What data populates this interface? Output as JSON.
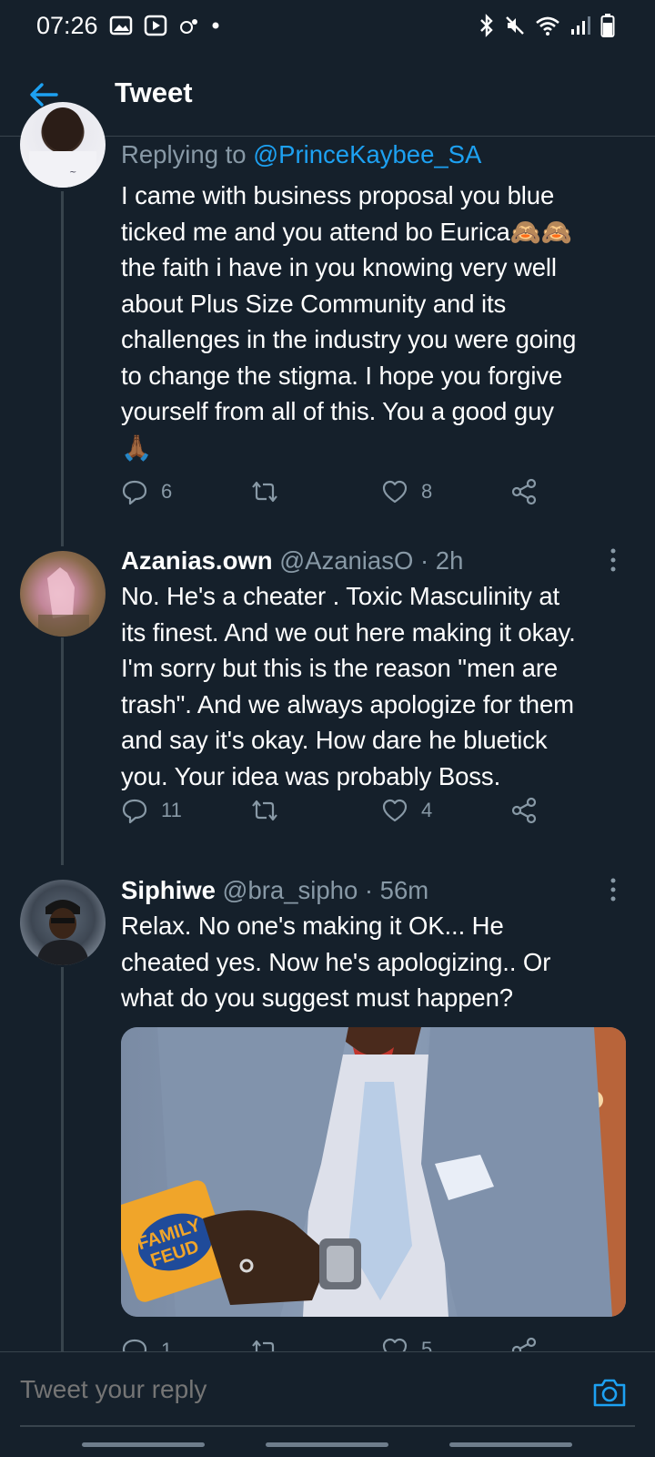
{
  "status_bar": {
    "time": "07:26",
    "icons_left": [
      "gallery-icon",
      "play-store-icon",
      "signal-notification-icon",
      "dot-icon"
    ],
    "icons_right": [
      "bluetooth-icon",
      "mute-icon",
      "wifi-icon",
      "cell-signal-icon",
      "battery-icon"
    ]
  },
  "header": {
    "title": "Tweet",
    "back_icon": "back-arrow-icon",
    "accent_color": "#1da1f2"
  },
  "tweets": [
    {
      "reply_prefix": "Replying to ",
      "reply_to": "@PrinceKaybee_SA",
      "text": "I came with business proposal you blue\nticked me and you attend bo Eurica🙈🙈\nthe faith i have in you knowing very well\nabout Plus Size Community and its\nchallenges in the industry you were going\nto change the stigma. I hope you forgive\nyourself from all of this. You a good guy\n🙏🏾",
      "replies": "6",
      "retweets": "",
      "likes": "8"
    },
    {
      "name": "Azanias.own",
      "handle_time": " @AzaniasO · 2h",
      "text": "No. He's a cheater . Toxic Masculinity at\nits finest. And we out here making it okay.\nI'm sorry but this is the reason \"men are\ntrash\". And we always apologize for them\nand say it's okay. How dare he bluetick\nyou. Your idea was probably Boss.",
      "replies": "11",
      "retweets": "",
      "likes": "4"
    },
    {
      "name": "Siphiwe",
      "handle_time": " @bra_sipho · 56m",
      "text": "Relax. No one's making it OK... He\ncheated yes. Now he's apologizing.. Or\nwhat do you suggest must happen?",
      "replies": "1",
      "retweets": "",
      "likes": "5",
      "media_card_text": "FAMILY\nFEUD"
    }
  ],
  "compose": {
    "placeholder": "Tweet your reply",
    "camera_icon": "camera-icon"
  },
  "colors": {
    "background": "#15202b",
    "secondary_text": "#8899a6",
    "divider": "#38444d",
    "accent": "#1da1f2"
  }
}
